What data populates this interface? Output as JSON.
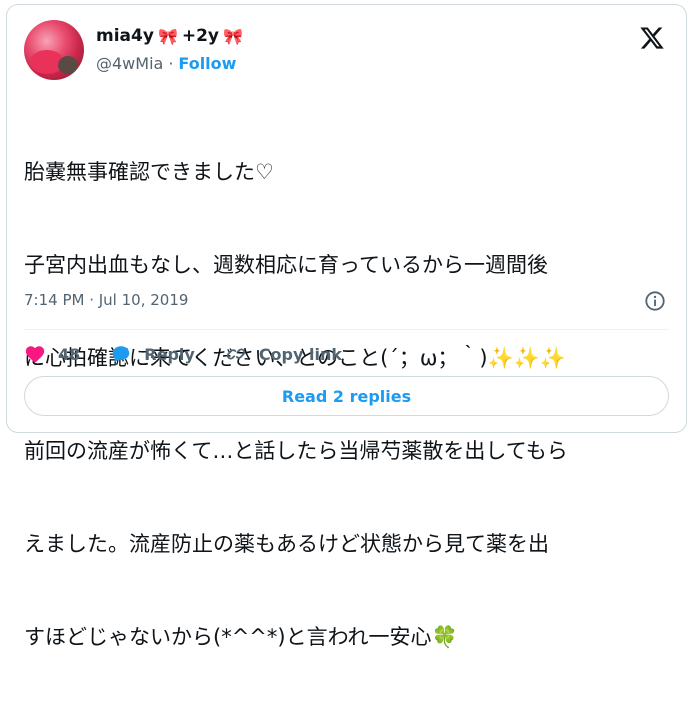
{
  "user": {
    "display_name": "mia4y",
    "display_suffix": "+2y",
    "handle": "@4wMia",
    "separator": "·",
    "follow_label": "Follow"
  },
  "tweet": {
    "lines": [
      "胎嚢無事確認できました♡",
      "子宮内出血もなし、週数相応に育っているから一週間後",
      "に心拍確認に来てください、とのこと(´；ω；｀)✨✨✨",
      "前回の流産が怖くて…と話したら当帰芍薬散を出してもら",
      "えました。流産防止の薬もあるけど状態から見て薬を出",
      "すほどじゃないから(*^^*)と言われ一安心🍀"
    ]
  },
  "meta": {
    "timestamp": "7:14 PM · Jul 10, 2019"
  },
  "actions": {
    "like_count": "48",
    "reply_label": "Reply",
    "copy_label": "Copy link"
  },
  "read_replies_label": "Read 2 replies",
  "colors": {
    "accent": "#1d9bf0",
    "like": "#f91880",
    "text_muted": "#536471"
  }
}
